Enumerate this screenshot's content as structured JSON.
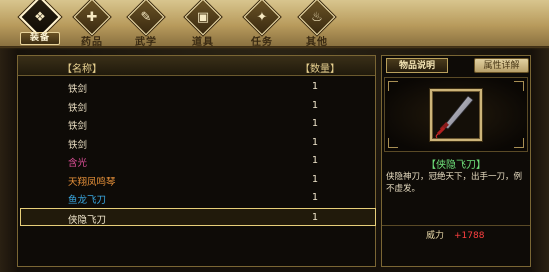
{
  "tabs": [
    {
      "label": "装备",
      "icon": "gear-armor-icon",
      "glyph": "❖",
      "active": true
    },
    {
      "label": "药品",
      "icon": "potion-icon",
      "glyph": "✚",
      "active": false
    },
    {
      "label": "武学",
      "icon": "martial-scroll-icon",
      "glyph": "✎",
      "active": false
    },
    {
      "label": "道具",
      "icon": "item-box-icon",
      "glyph": "▣",
      "active": false
    },
    {
      "label": "任务",
      "icon": "quest-icon",
      "glyph": "✦",
      "active": false
    },
    {
      "label": "其他",
      "icon": "flame-icon",
      "glyph": "♨",
      "active": false
    }
  ],
  "list": {
    "header_name": "【名称】",
    "header_qty": "【数量】",
    "rows": [
      {
        "name": "铁剑",
        "qty": "1",
        "color": "#e8dcc0"
      },
      {
        "name": "铁剑",
        "qty": "1",
        "color": "#e8dcc0"
      },
      {
        "name": "铁剑",
        "qty": "1",
        "color": "#e8dcc0"
      },
      {
        "name": "铁剑",
        "qty": "1",
        "color": "#e8dcc0"
      },
      {
        "name": "含光",
        "qty": "1",
        "color": "#e0509a"
      },
      {
        "name": "天翔凤鸣琴",
        "qty": "1",
        "color": "#e8923a"
      },
      {
        "name": "鱼龙飞刀",
        "qty": "1",
        "color": "#3aa8e0"
      },
      {
        "name": "侠隐飞刀",
        "qty": "1",
        "color": "#f0e6cc",
        "selected": true
      }
    ]
  },
  "detail": {
    "tab_desc": "物品说明",
    "tab_attr": "属性详解",
    "item_title": "【侠隐飞刀】",
    "item_desc": "侠隐神刀，冠绝天下，出手一刀，例不虚发。",
    "stat_label": "威力",
    "stat_value": "+1788"
  }
}
